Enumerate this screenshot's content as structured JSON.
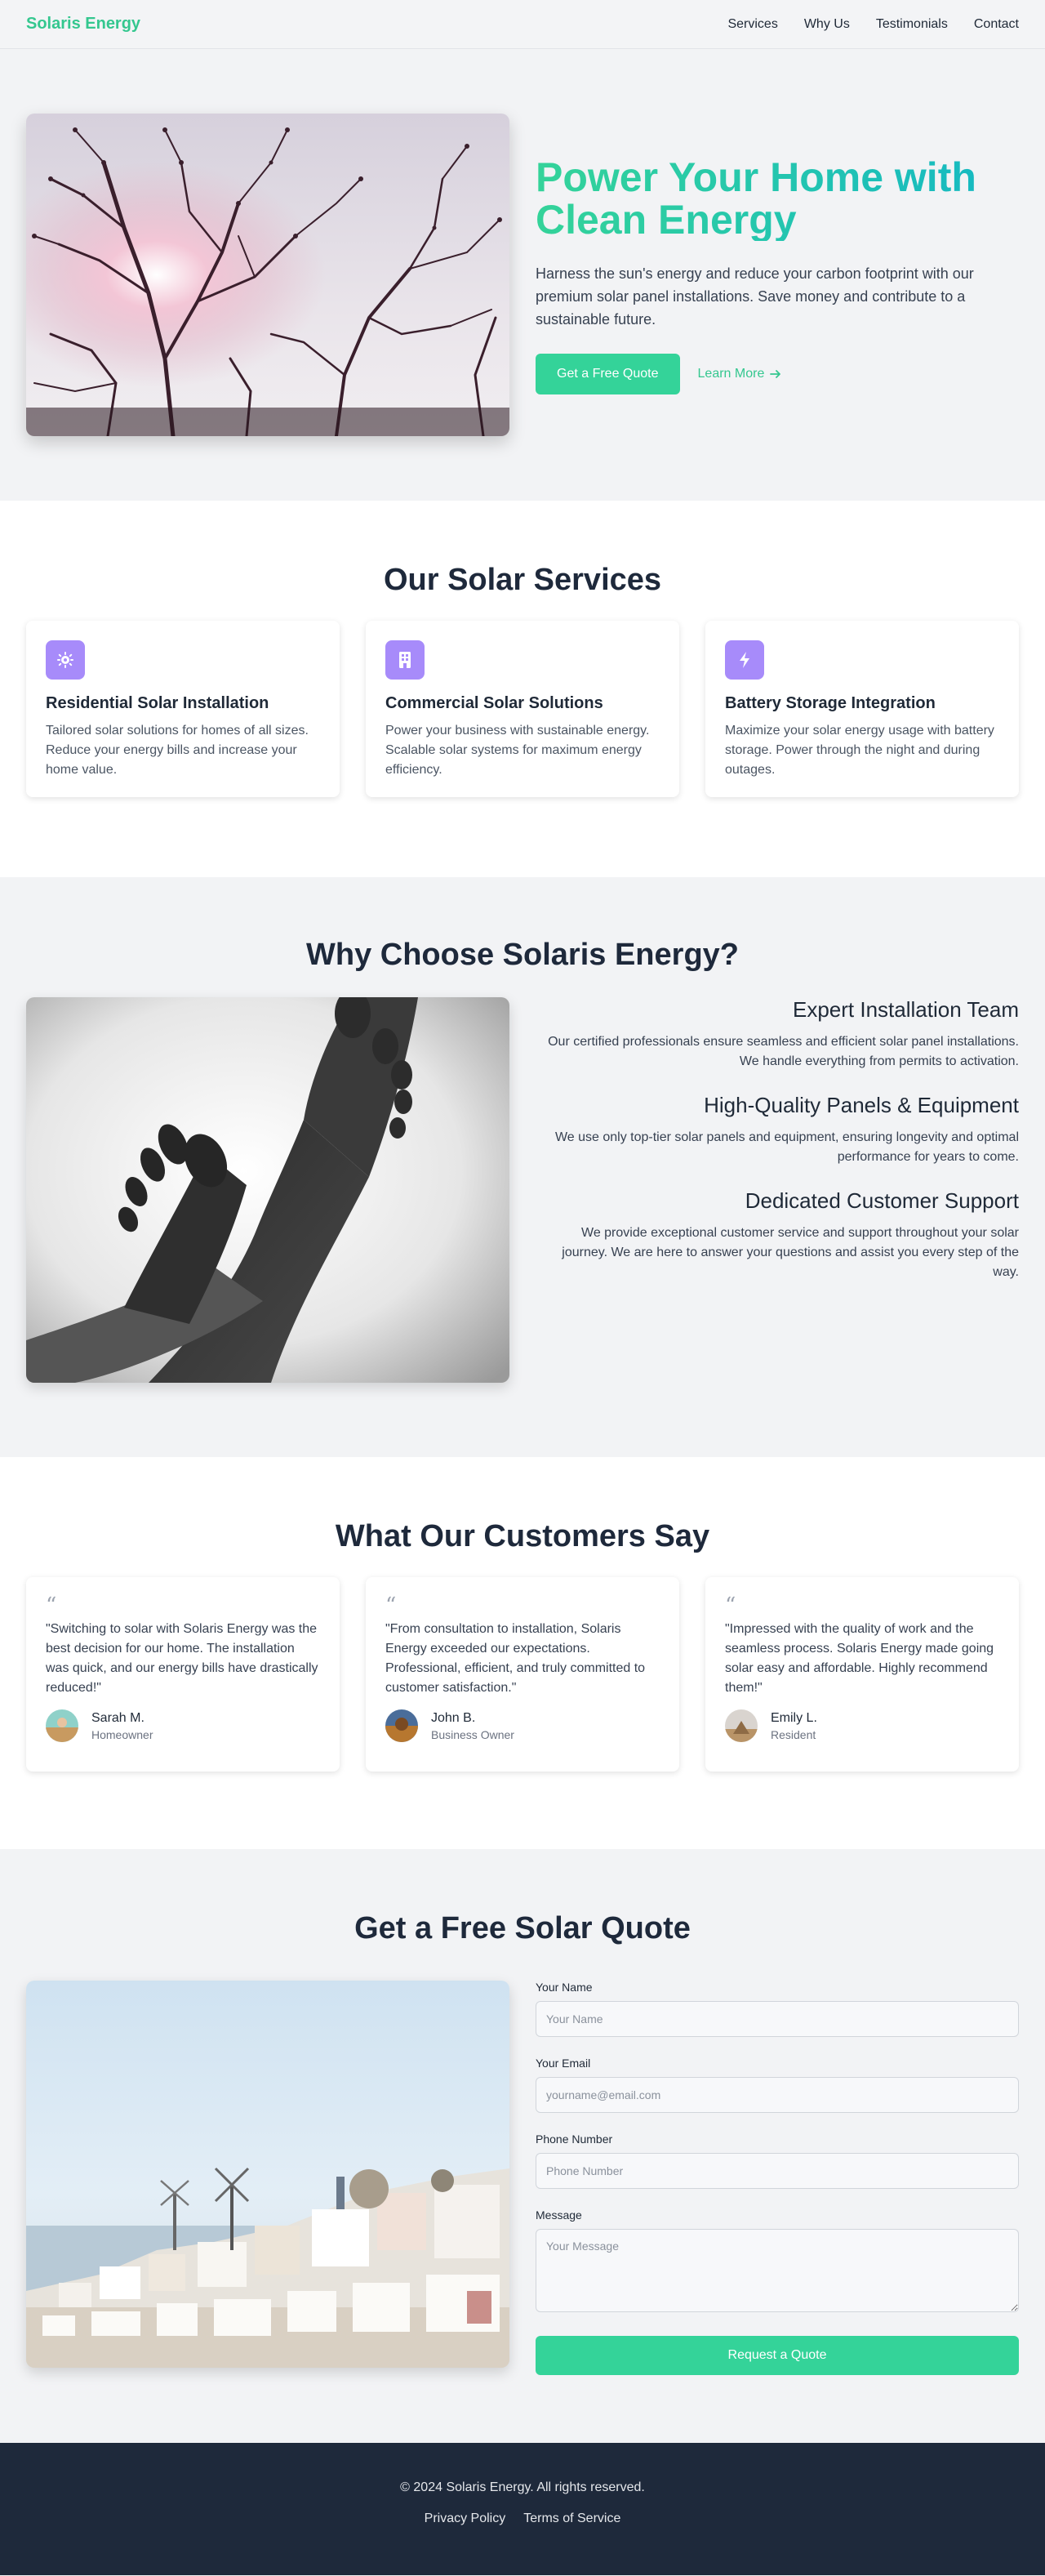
{
  "nav": {
    "brand": "Solaris Energy",
    "links": [
      "Services",
      "Why Us",
      "Testimonials",
      "Contact"
    ]
  },
  "hero": {
    "title": "Power Your Home with Clean Energy",
    "subtitle": "Harness the sun's energy and reduce your carbon footprint with our premium solar panel installations. Save money and contribute to a sustainable future.",
    "cta_primary": "Get a Free Quote",
    "cta_secondary": "Learn More"
  },
  "services": {
    "title": "Our Solar Services",
    "items": [
      {
        "icon": "sun-gear-icon",
        "title": "Residential Solar Installation",
        "text": "Tailored solar solutions for homes of all sizes. Reduce your energy bills and increase your home value."
      },
      {
        "icon": "building-icon",
        "title": "Commercial Solar Solutions",
        "text": "Power your business with sustainable energy. Scalable solar systems for maximum energy efficiency."
      },
      {
        "icon": "lightning-icon",
        "title": "Battery Storage Integration",
        "text": "Maximize your solar energy usage with battery storage. Power through the night and during outages."
      }
    ]
  },
  "why": {
    "title": "Why Choose Solaris Energy?",
    "items": [
      {
        "title": "Expert Installation Team",
        "text": "Our certified professionals ensure seamless and efficient solar panel installations. We handle everything from permits to activation."
      },
      {
        "title": "High-Quality Panels & Equipment",
        "text": "We use only top-tier solar panels and equipment, ensuring longevity and optimal performance for years to come."
      },
      {
        "title": "Dedicated Customer Support",
        "text": "We provide exceptional customer service and support throughout your solar journey. We are here to answer your questions and assist you every step of the way."
      }
    ]
  },
  "testimonials": {
    "title": "What Our Customers Say",
    "quote_mark": "“",
    "items": [
      {
        "quote": "\"Switching to solar with Solaris Energy was the best decision for our home. The installation was quick, and our energy bills have drastically reduced!\"",
        "name": "Sarah M.",
        "role": "Homeowner"
      },
      {
        "quote": "\"From consultation to installation, Solaris Energy exceeded our expectations. Professional, efficient, and truly committed to customer satisfaction.\"",
        "name": "John B.",
        "role": "Business Owner"
      },
      {
        "quote": "\"Impressed with the quality of work and the seamless process. Solaris Energy made going solar easy and affordable. Highly recommend them!\"",
        "name": "Emily L.",
        "role": "Resident"
      }
    ]
  },
  "quote": {
    "title": "Get a Free Solar Quote",
    "fields": {
      "name": {
        "label": "Your Name",
        "placeholder": "Your Name",
        "value": ""
      },
      "email": {
        "label": "Your Email",
        "placeholder": "yourname@email.com",
        "value": ""
      },
      "phone": {
        "label": "Phone Number",
        "placeholder": "Phone Number",
        "value": ""
      },
      "message": {
        "label": "Message",
        "placeholder": "Your Message",
        "value": ""
      }
    },
    "submit": "Request a Quote"
  },
  "footer": {
    "copyright": "© 2024 Solaris Energy. All rights reserved.",
    "links": [
      "Privacy Policy",
      "Terms of Service"
    ]
  },
  "colors": {
    "accent": "#34d399",
    "brand_text": "#34c78f",
    "icon_bg": "#a78bfa",
    "footer_bg": "#1e293b"
  }
}
